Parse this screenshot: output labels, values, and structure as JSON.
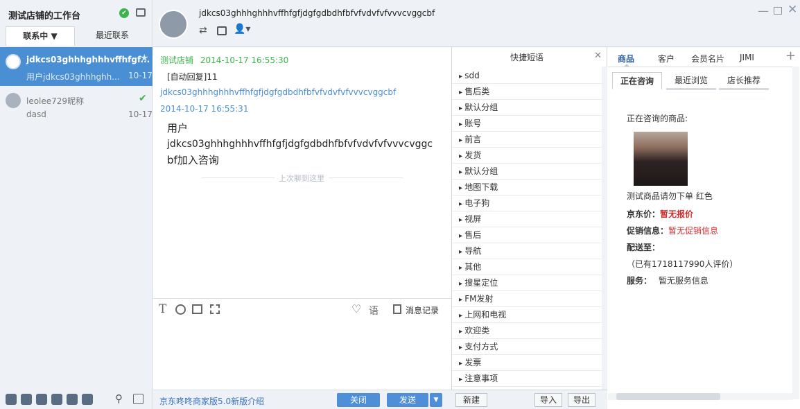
{
  "left_panel": {
    "title": "测试店铺的工作台",
    "tabs": [
      "联系中 ▼",
      "最近联系"
    ],
    "contacts": [
      {
        "name": "jdkcs03ghhhghhhvffhfgf...",
        "message": "用户jdkcs03ghhhghh...",
        "date": "10-17",
        "starred": true
      },
      {
        "name": "leolee729昵称",
        "message": "dasd",
        "date": "10-17",
        "starred": false
      }
    ]
  },
  "header": {
    "contact_name": "jdkcs03ghhhghhhvffhfgfjdgfgdbdhfbfvfvdvfvfvvvcvggcbf"
  },
  "chat": {
    "messages": [
      {
        "sender": "测试店铺",
        "time": "2014-10-17 16:55:30",
        "text": "[自动回复]11"
      },
      {
        "sender": "jdkcs03ghhhghhhvffhfgfjdgfgdbdhfbfvfvdvfvfvvvcvggcbf",
        "time": "2014-10-17 16:55:31",
        "text_lines": [
          "用户",
          "jdkcs03ghhhghhhvffhfgfjdgfgdbdhfbfvfvdvfvfvvvcvggc",
          "bf加入咨询"
        ]
      }
    ],
    "divider": "上次聊到这里",
    "toolbar": {
      "phrase": "语",
      "history": "消息记录"
    },
    "bottom": {
      "intro_link": "京东咚咚商家版5.0新版介绍",
      "close": "关闭",
      "send": "发送"
    }
  },
  "phrases": {
    "title": "快捷短语",
    "items": [
      "sdd",
      "售后类",
      "默认分组",
      "账号",
      "前言",
      "发货",
      "默认分组",
      "地图下载",
      "电子狗",
      "视屏",
      "售后",
      "导航",
      "其他",
      "搜星定位",
      "FM发射",
      "上网和电视",
      "欢迎类",
      "支付方式",
      "发票",
      "注意事项"
    ],
    "buttons": {
      "new": "新建",
      "import": "导入",
      "export": "导出"
    }
  },
  "right_panel": {
    "tabs": [
      "商品",
      "客户",
      "会员名片",
      "JIMI"
    ],
    "subtabs": [
      "正在咨询",
      "最近浏览",
      "店长推荐"
    ],
    "consulting_label": "正在咨询的商品:",
    "product_name": "测试商品请勿下单 红色",
    "price_label": "京东价：",
    "price_value": "暂无报价",
    "promo_label": "促销信息：",
    "promo_value": "暂无促销信息",
    "ship_label": "配送至：",
    "reviews": "（已有1718117990人评价）",
    "service_label": "服务：",
    "service_value": "暂无服务信息"
  },
  "colors": {
    "accent": "#4a8fd4",
    "green": "#3bb54a",
    "red": "#d32a2a"
  }
}
